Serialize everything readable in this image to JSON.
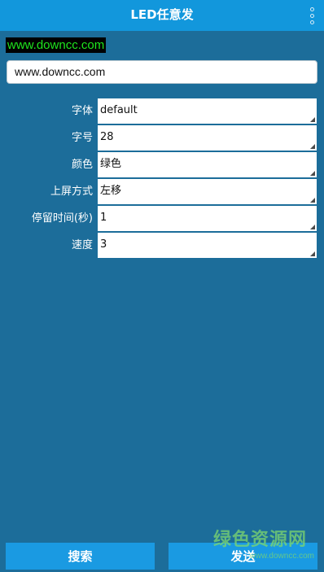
{
  "app": {
    "title": "LED任意发"
  },
  "preview": {
    "text": "www.downcc.com",
    "bg_color": "#000000",
    "text_color": "#1ee61e"
  },
  "input": {
    "value": "www.downcc.com"
  },
  "settings": {
    "font": {
      "label": "字体",
      "value": "default"
    },
    "size": {
      "label": "字号",
      "value": "28"
    },
    "color": {
      "label": "颜色",
      "value": "绿色"
    },
    "mode": {
      "label": "上屏方式",
      "value": "左移"
    },
    "duration": {
      "label": "停留时间(秒)",
      "value": "1"
    },
    "speed": {
      "label": "速度",
      "value": "3"
    }
  },
  "buttons": {
    "search": "搜索",
    "send": "发送"
  },
  "watermark": {
    "main": "绿色资源网",
    "url": "www.downcc.com"
  },
  "colors": {
    "background": "#1c6d9a",
    "app_bar": "#1297dc",
    "button": "#1a9ae2"
  },
  "icons": {
    "menu": "overflow-menu-icon",
    "dropdown": "dropdown-arrow-icon"
  }
}
